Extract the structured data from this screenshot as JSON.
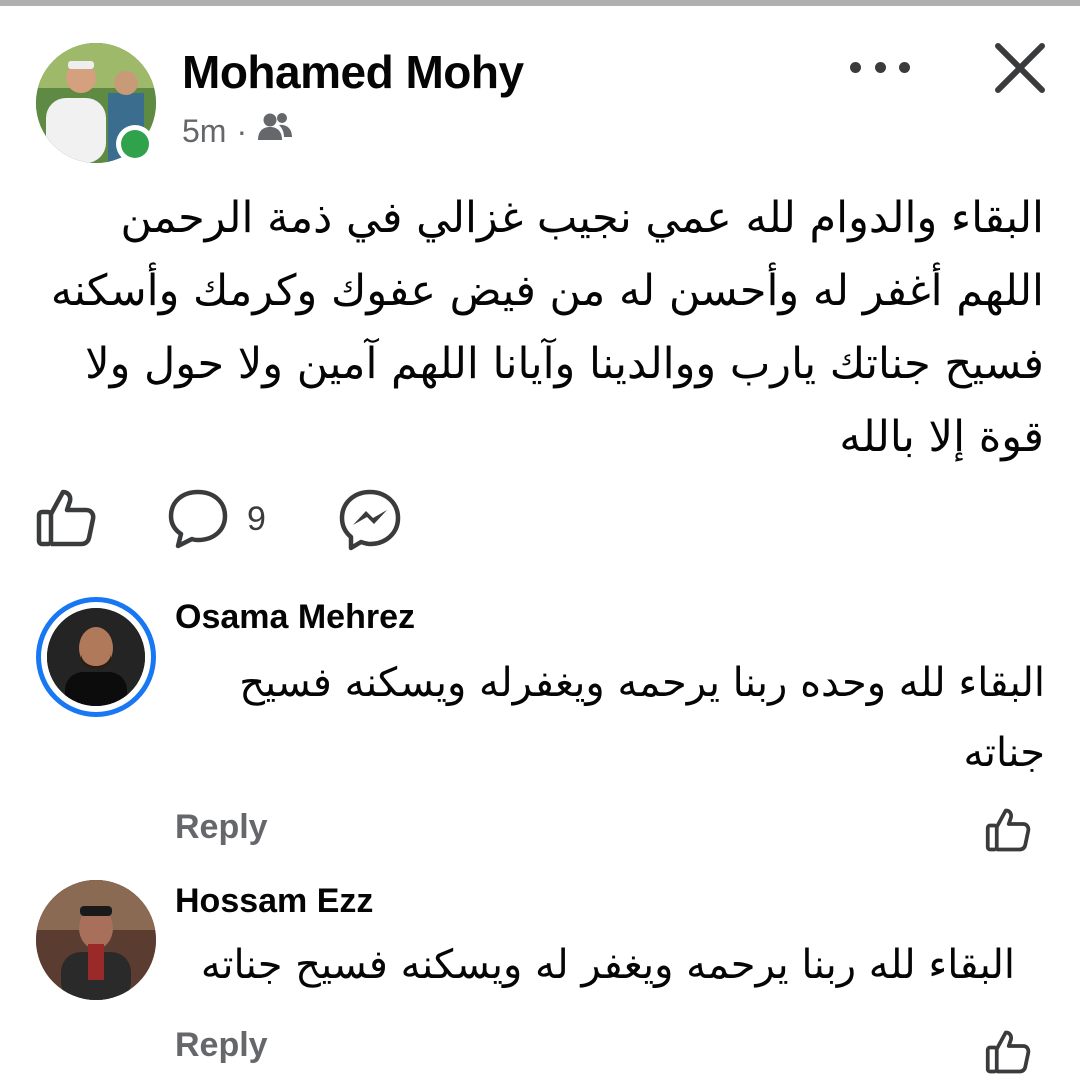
{
  "post": {
    "author": "Mohamed Mohy",
    "time": "5m",
    "separator": "·",
    "audience_icon": "friends-icon",
    "body": "البقاء والدوام لله عمي نجيب غزالي في ذمة الرحمن اللهم أغفر له وأحسن له من فيض عفوك وكرمك وأسكنه فسيح جناتك يارب ووالدينا وآيانا اللهم آمين ولا حول ولا قوة إلا بالله"
  },
  "actions": {
    "comment_count": "9",
    "icons": [
      "like-icon",
      "comment-icon",
      "messenger-icon"
    ]
  },
  "comments": [
    {
      "author": "Osama Mehrez",
      "text": "البقاء لله وحده ربنا يرحمه ويغفرله ويسكنه فسيح جناته",
      "reply_label": "Reply"
    },
    {
      "author": "Hossam Ezz",
      "text": "البقاء لله ربنا يرحمه ويغفر له ويسكنه فسيح جناته",
      "reply_label": "Reply"
    }
  ],
  "colors": {
    "online": "#31a24c",
    "story_ring": "#1877f2",
    "secondary_text": "#65676b"
  }
}
